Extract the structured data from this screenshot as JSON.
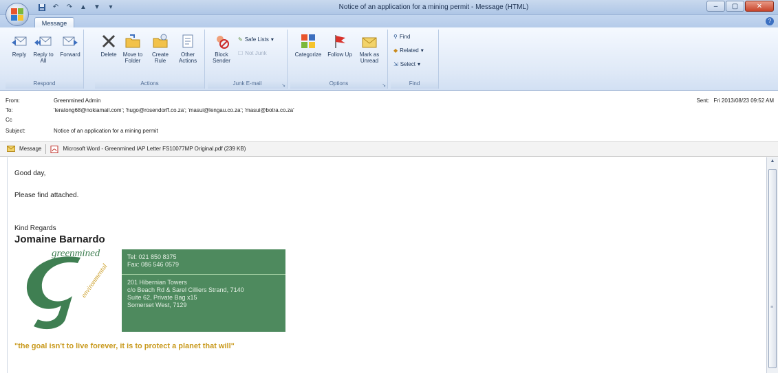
{
  "window": {
    "title": "Notice of an application for a mining permit - Message (HTML)"
  },
  "ribbon": {
    "active_tab": "Message",
    "groups": {
      "respond": {
        "label": "Respond",
        "reply": "Reply",
        "reply_all": "Reply to All",
        "forward": "Forward"
      },
      "actions": {
        "label": "Actions",
        "delete": "Delete",
        "move_to_folder": "Move to Folder",
        "create_rule": "Create Rule",
        "other_actions": "Other Actions"
      },
      "junk": {
        "label": "Junk E-mail",
        "block_sender": "Block Sender",
        "safe_lists": "Safe Lists",
        "not_junk": "Not Junk"
      },
      "options": {
        "label": "Options",
        "categorize": "Categorize",
        "follow_up": "Follow Up",
        "mark_as_unread": "Mark as Unread"
      },
      "find": {
        "label": "Find",
        "find": "Find",
        "related": "Related",
        "select": "Select"
      }
    }
  },
  "header": {
    "from_label": "From:",
    "from": "Greenmined Admin",
    "to_label": "To:",
    "to": "'leratong68@nokiamail.com'; 'hugo@rosendorff.co.za'; 'masui@lengau.co.za'; 'masui@botra.co.za'",
    "cc_label": "Cc",
    "cc": "",
    "subject_label": "Subject:",
    "subject": "Notice of an application for a mining permit",
    "sent_label": "Sent:",
    "sent": "Fri 2013/08/23 09:52 AM"
  },
  "attachments": {
    "message": "Message",
    "file": "Microsoft Word - Greenmined IAP Letter FS10077MP Original.pdf (239 KB)"
  },
  "body": {
    "greeting": "Good day,",
    "line1": "Please find attached.",
    "regards": "Kind Regards",
    "signature_name": "Jomaine Barnardo",
    "logo_text_top": "greenmined",
    "logo_text_right": "environmental",
    "contact": {
      "tel": "Tel: 021 850 8375",
      "fax": "Fax: 086 546 0579",
      "address1": "201 Hibernian Towers",
      "address2": "c/o Beach Rd & Sarel Cilliers Strand, 7140",
      "address3": "Suite 62, Private Bag x15",
      "address4": "Somerset West, 7129"
    },
    "slogan": "\"the goal isn't to live forever, it is to protect a planet that will\""
  },
  "colors": {
    "contact_bg": "#4e8a5e",
    "slogan": "#c99a1e",
    "logo_green": "#3f7f52"
  }
}
